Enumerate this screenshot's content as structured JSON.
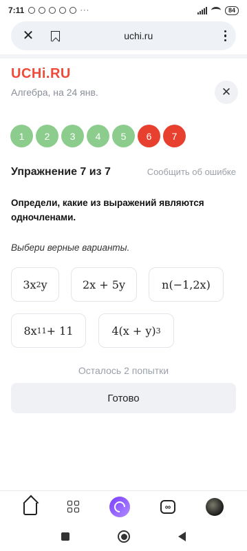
{
  "status_bar": {
    "time": "7:11",
    "more": "···",
    "battery": "84"
  },
  "browser": {
    "url": "uchi.ru"
  },
  "header": {
    "logo": "UCHi.RU",
    "subtitle": "Алгебра, на 24 янв."
  },
  "steps": [
    {
      "label": "1",
      "state": "done"
    },
    {
      "label": "2",
      "state": "done"
    },
    {
      "label": "3",
      "state": "done"
    },
    {
      "label": "4",
      "state": "done"
    },
    {
      "label": "5",
      "state": "done"
    },
    {
      "label": "6",
      "state": "wrong"
    },
    {
      "label": "7",
      "state": "wrong"
    }
  ],
  "exercise": {
    "title": "Упражнение 7 из 7",
    "report": "Сообщить об ошибке",
    "question": "Определи, какие из выражений являются одночленами.",
    "hint": "Выбери верные варианты."
  },
  "options": [
    {
      "base": "3x",
      "sup": "2",
      "tail": "y"
    },
    {
      "base": "2x + 5y",
      "sup": "",
      "tail": ""
    },
    {
      "base": "n(−1,2x)",
      "sup": "",
      "tail": ""
    },
    {
      "base": "8x",
      "sup": "11",
      "tail": " + 11"
    },
    {
      "base": "4(x + y)",
      "sup": "3",
      "tail": ""
    }
  ],
  "attempts": "Осталось 2 попытки",
  "submit_label": "Готово",
  "colors": {
    "done": "#8ccd8e",
    "wrong": "#e8402e",
    "brand": "#ee4b3b"
  }
}
